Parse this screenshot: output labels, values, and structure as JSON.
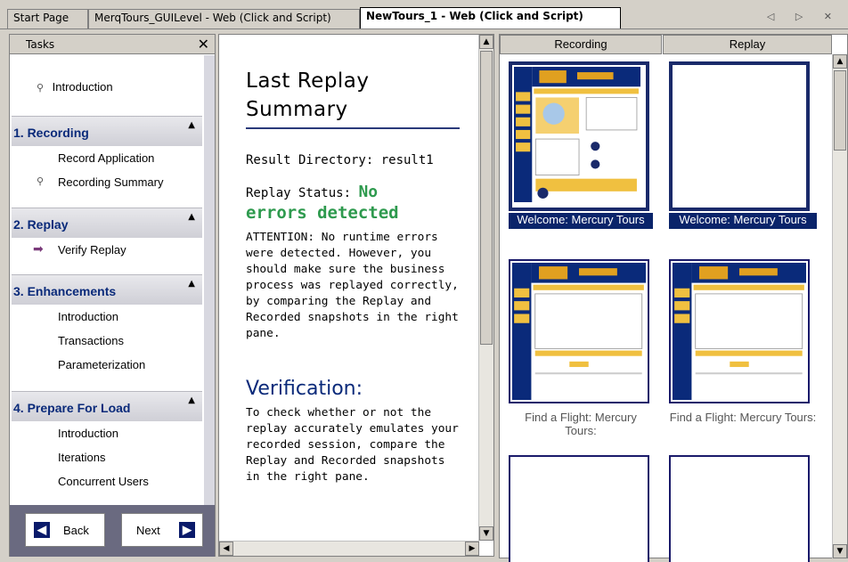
{
  "tabs": [
    {
      "label": "Start Page"
    },
    {
      "label": "MerqTours_GUILevel - Web (Click and Script)"
    },
    {
      "label": "NewTours_1 - Web (Click and Script)"
    }
  ],
  "tab_nav": "◁ ▷ ✕",
  "tasks": {
    "title": "Tasks",
    "close": "✕",
    "intro": "Introduction",
    "groups": [
      {
        "title": "1. Recording",
        "items": [
          "Record Application",
          "Recording Summary"
        ]
      },
      {
        "title": "2. Replay",
        "items": [
          "Verify Replay"
        ]
      },
      {
        "title": "3. Enhancements",
        "items": [
          "Introduction",
          "Transactions",
          "Parameterization"
        ]
      },
      {
        "title": "4. Prepare For Load",
        "items": [
          "Introduction",
          "Iterations",
          "Concurrent Users"
        ]
      }
    ],
    "back_label": "Back",
    "next_label": "Next"
  },
  "summary": {
    "title_line1": "Last Replay",
    "title_line2": "Summary",
    "result_dir": "Result Directory: result1",
    "status_prefix": "Replay Status: ",
    "status_value_a": "No",
    "status_value_b": "errors detected",
    "attention": "ATTENTION: No runtime errors were detected. However, you should make sure the business process was replayed correctly, by comparing the Replay and Recorded snapshots in the right pane.",
    "verification_title": "Verification:",
    "verification_text": "To check whether or not the replay accurately emulates your recorded session, compare the Replay and Recorded snapshots in the right pane."
  },
  "snapshots": {
    "col_recording": "Recording",
    "col_replay": "Replay",
    "captions": {
      "welcome": "Welcome: Mercury Tours",
      "find_flight": "Find a Flight: Mercury Tours:"
    }
  }
}
